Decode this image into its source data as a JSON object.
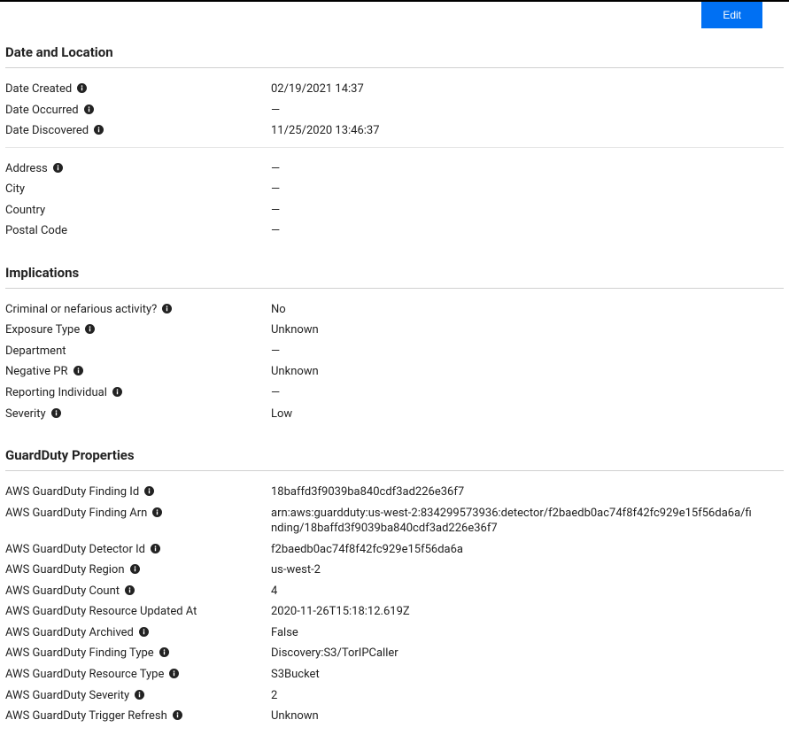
{
  "edit_button_label": "Edit",
  "em_dash": "—",
  "sections": {
    "date_location": {
      "title": "Date and Location",
      "fields": {
        "date_created": {
          "label": "Date Created",
          "value": "02/19/2021 14:37",
          "info": true
        },
        "date_occurred": {
          "label": "Date Occurred",
          "value": "—",
          "info": true
        },
        "date_discovered": {
          "label": "Date Discovered",
          "value": "11/25/2020 13:46:37",
          "info": true
        },
        "address": {
          "label": "Address",
          "value": "—",
          "info": true
        },
        "city": {
          "label": "City",
          "value": "—",
          "info": false
        },
        "country": {
          "label": "Country",
          "value": "—",
          "info": false
        },
        "postal_code": {
          "label": "Postal Code",
          "value": "—",
          "info": false
        }
      }
    },
    "implications": {
      "title": "Implications",
      "fields": {
        "criminal": {
          "label": "Criminal or nefarious activity?",
          "value": "No",
          "info": true
        },
        "exposure_type": {
          "label": "Exposure Type",
          "value": "Unknown",
          "info": true
        },
        "department": {
          "label": "Department",
          "value": "—",
          "info": false
        },
        "negative_pr": {
          "label": "Negative PR",
          "value": "Unknown",
          "info": true
        },
        "reporting_individual": {
          "label": "Reporting Individual",
          "value": "—",
          "info": true
        },
        "severity": {
          "label": "Severity",
          "value": "Low",
          "info": true
        }
      }
    },
    "guardduty": {
      "title": "GuardDuty Properties",
      "fields": {
        "finding_id": {
          "label": "AWS GuardDuty Finding Id",
          "value": "18baffd3f9039ba840cdf3ad226e36f7",
          "info": true
        },
        "finding_arn": {
          "label": "AWS GuardDuty Finding Arn",
          "value": "arn:aws:guardduty:us-west-2:834299573936:detector/f2baedb0ac74f8f42fc929e15f56da6a/finding/18baffd3f9039ba840cdf3ad226e36f7",
          "info": true
        },
        "detector_id": {
          "label": "AWS GuardDuty Detector Id",
          "value": "f2baedb0ac74f8f42fc929e15f56da6a",
          "info": true
        },
        "region": {
          "label": "AWS GuardDuty Region",
          "value": "us-west-2",
          "info": true
        },
        "count": {
          "label": "AWS GuardDuty Count",
          "value": "4",
          "info": true
        },
        "resource_updated_at": {
          "label": "AWS GuardDuty Resource Updated At",
          "value": "2020-11-26T15:18:12.619Z",
          "info": false
        },
        "archived": {
          "label": "AWS GuardDuty Archived",
          "value": "False",
          "info": true
        },
        "finding_type": {
          "label": "AWS GuardDuty Finding Type",
          "value": "Discovery:S3/TorIPCaller",
          "info": true
        },
        "resource_type": {
          "label": "AWS GuardDuty Resource Type",
          "value": "S3Bucket",
          "info": true
        },
        "severity": {
          "label": "AWS GuardDuty Severity",
          "value": "2",
          "info": true
        },
        "trigger_refresh": {
          "label": "AWS GuardDuty Trigger Refresh",
          "value": "Unknown",
          "info": true
        }
      }
    }
  }
}
